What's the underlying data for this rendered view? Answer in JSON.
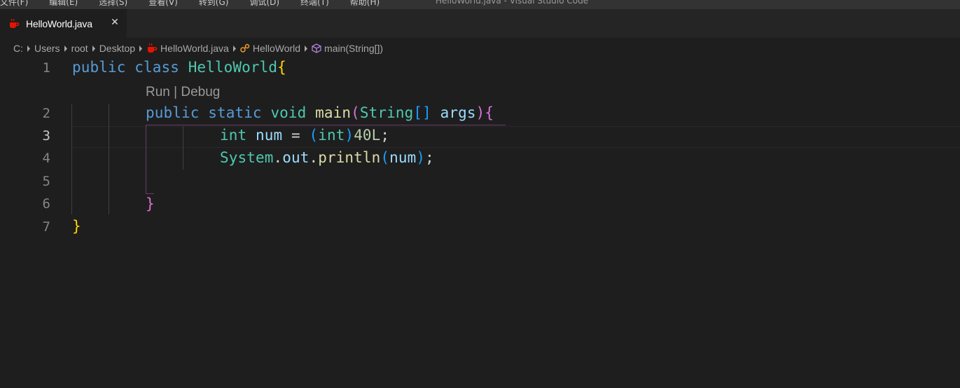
{
  "titlebar": {
    "menu": [
      "文件(F)",
      "编辑(E)",
      "选择(S)",
      "查看(V)",
      "转到(G)",
      "调试(D)",
      "终端(T)",
      "帮助(H)"
    ],
    "window_title": "HelloWorld.java - Visual Studio Code"
  },
  "tab": {
    "label": "HelloWorld.java",
    "close": "✕"
  },
  "breadcrumb": {
    "items": [
      "C:",
      "Users",
      "root",
      "Desktop",
      "HelloWorld.java",
      "HelloWorld",
      "main(String[])"
    ]
  },
  "editor": {
    "codelens": "Run | Debug",
    "line_numbers": [
      "1",
      "2",
      "3",
      "4",
      "5",
      "6",
      "7"
    ],
    "active_line": "3"
  },
  "colors": {
    "keyword": "#569cd6",
    "type": "#4ec9b0",
    "function": "#dcdcaa",
    "variable": "#9cdcfe",
    "number": "#b5cea8",
    "bracket1": "#ffd700",
    "bracket2": "#da70d6",
    "bracket3": "#179fff",
    "java_icon": "#e51400"
  }
}
